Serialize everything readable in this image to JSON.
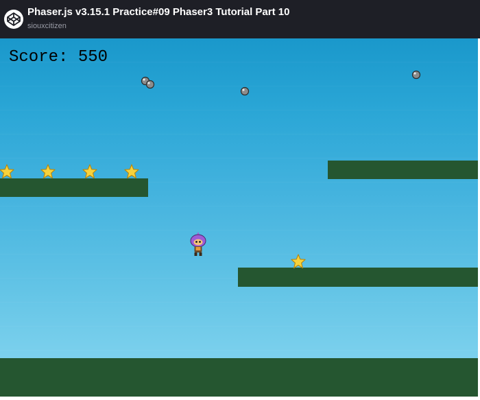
{
  "header": {
    "title": "Phaser.js v3.15.1 Practice#09 Phaser3 Tutorial Part 10",
    "author": "siouxcitizen",
    "logo_icon": "codepen-logo-icon"
  },
  "game": {
    "score_text": "Score: 550",
    "colors": {
      "sky_top": "#1a98cb",
      "sky_bottom": "#8ad8f1",
      "platform": "#255630",
      "star": "#f7d23c",
      "bomb": "#8c8c8c",
      "score_text": "#000000",
      "header_bg": "#1e1f26"
    },
    "sprites": {
      "star": "star-icon",
      "bomb": "bomb-icon",
      "player": "player-character"
    }
  }
}
